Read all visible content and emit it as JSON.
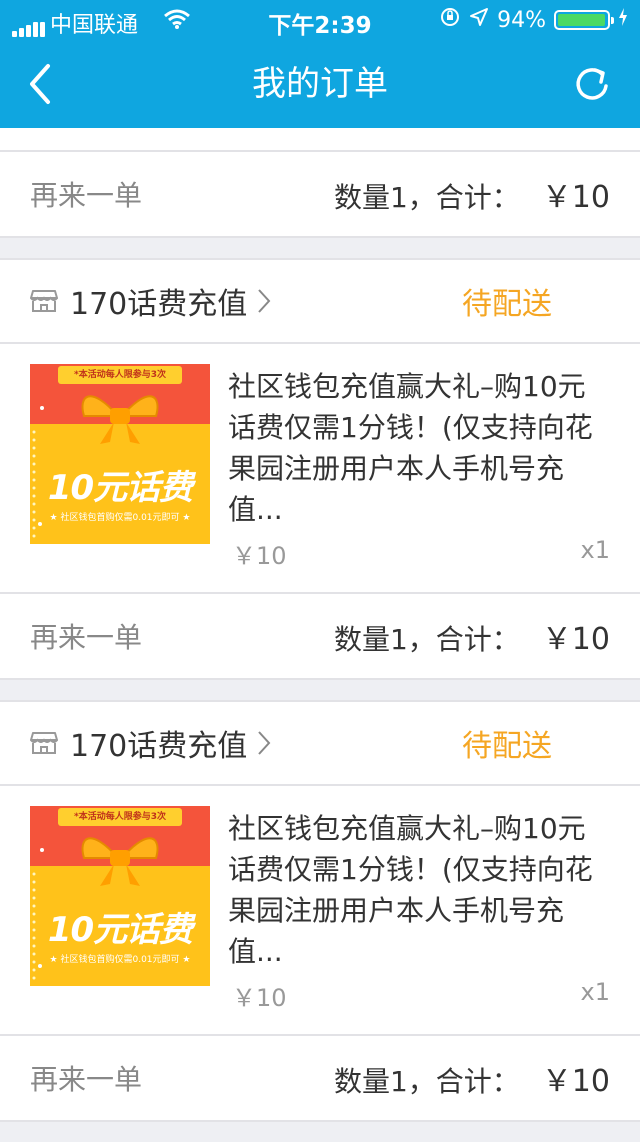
{
  "status_bar": {
    "carrier": "中国联通",
    "time": "下午2:39",
    "battery": "94%",
    "battery_level": 0.94
  },
  "navbar": {
    "title": "我的订单",
    "back_icon": "chevron-left-icon",
    "refresh_icon": "refresh-icon"
  },
  "colors": {
    "header": "#0fa6e0",
    "status_pending": "#f5a623",
    "background": "#eeeff3"
  },
  "top_order": {
    "reorder": "再来一单",
    "qty_total_label": "数量1，合计：",
    "total": "￥10"
  },
  "orders": [
    {
      "shop": "170话费充值",
      "status": "待配送",
      "item": {
        "title": "社区钱包充值赢大礼–购10元话费仅需1分钱！(仅支持向花果园注册用户本人手机号充值...",
        "price": "￥10",
        "qty": "x1",
        "image": {
          "banner": "*本活动每人限参与3次",
          "big_text": "10元话费",
          "sub_text": "★ 社区钱包首购仅需0.01元即可 ★"
        }
      },
      "reorder": "再来一单",
      "qty_total_label": "数量1，合计：",
      "total": "￥10"
    },
    {
      "shop": "170话费充值",
      "status": "待配送",
      "item": {
        "title": "社区钱包充值赢大礼–购10元话费仅需1分钱！(仅支持向花果园注册用户本人手机号充值...",
        "price": "￥10",
        "qty": "x1",
        "image": {
          "banner": "*本活动每人限参与3次",
          "big_text": "10元话费",
          "sub_text": "★ 社区钱包首购仅需0.01元即可 ★"
        }
      },
      "reorder": "再来一单",
      "qty_total_label": "数量1，合计：",
      "total": "￥10"
    }
  ]
}
